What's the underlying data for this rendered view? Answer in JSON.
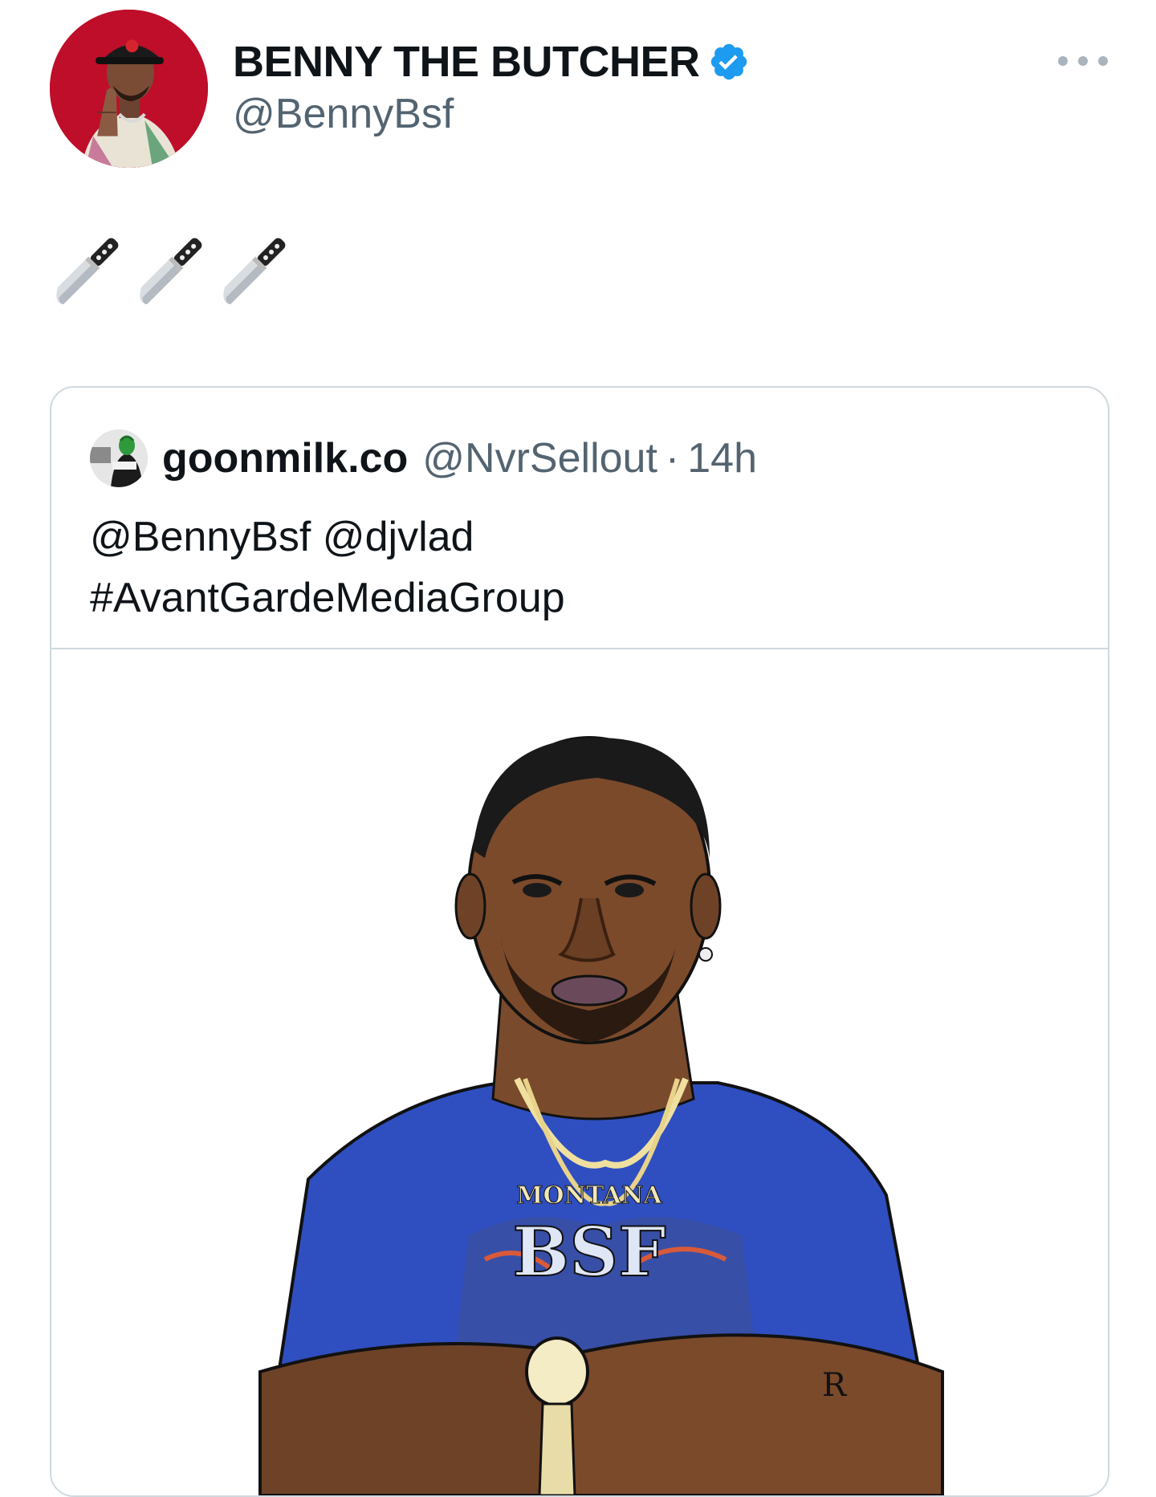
{
  "author": {
    "display_name": "BENNY THE BUTCHER",
    "handle": "@BennyBsf",
    "verified": true,
    "avatar_icon": "profile-photo"
  },
  "tweet": {
    "emoji": [
      "🔪",
      "🔪",
      "🔪"
    ]
  },
  "more_icon": "more-horizontal-icon",
  "quote": {
    "name": "goonmilk.co",
    "handle": "@NvrSellout",
    "separator": "·",
    "time": "14h",
    "lines": [
      "@BennyBsf @djvlad",
      "#AvantGardeMediaGroup"
    ],
    "media": {
      "chain_pendant_text": "MONTANA",
      "shirt_text": "BSF",
      "tattoo_text": "R"
    }
  },
  "colors": {
    "verified_blue": "#1d9bf0",
    "text_primary": "#0f1419",
    "text_secondary": "#536471",
    "border": "#cfd9de",
    "avatar_bg": "#c8102e",
    "shirt_blue": "#2f4fc0"
  }
}
